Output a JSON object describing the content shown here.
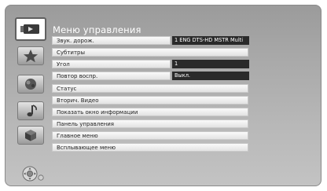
{
  "menu": {
    "title": "Меню управления",
    "items": [
      {
        "label": "Звук. дорож.",
        "value": "1 ENG DTS-HD MSTR Multi"
      },
      {
        "label": "Субтитры"
      },
      {
        "label": "Угол",
        "value": "1"
      },
      {
        "label": "Повтор воспр.",
        "value": "Выкл."
      },
      {
        "label": "Статус"
      },
      {
        "label": "Вторич. Видео"
      },
      {
        "label": "Показать окно информации"
      },
      {
        "label": "Панель управления"
      },
      {
        "label": "Главное меню"
      },
      {
        "label": "Всплывающее меню"
      }
    ]
  },
  "sidebar": {
    "icons": [
      "disc-play-icon",
      "star-icon",
      "photo-icon",
      "music-note-icon",
      "cube-icon"
    ]
  },
  "footer": {
    "icon": "remote-dpad-icon"
  }
}
